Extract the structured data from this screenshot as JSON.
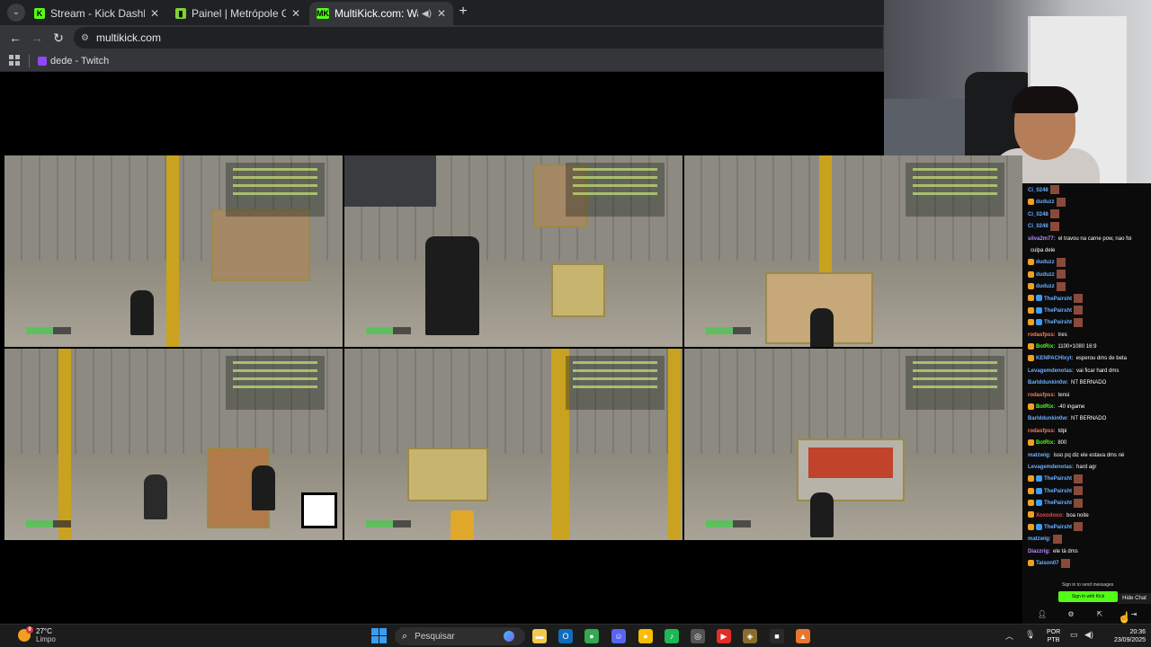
{
  "browser": {
    "tabs": [
      {
        "title": "Stream - Kick Dashboard",
        "favicon": "kick-icon",
        "color": "#53fc18",
        "active": false
      },
      {
        "title": "Painel | Metrópole GG",
        "favicon": "metropole-icon",
        "color": "#7fd33a",
        "active": false
      },
      {
        "title": "MultiKick.com: Watch Multi",
        "favicon": "multikick-icon",
        "color": "#53fc18",
        "active": true
      }
    ],
    "url": "multikick.com",
    "bookmark": "dede - Twitch"
  },
  "chat": {
    "messages": [
      {
        "user": "Ci_0248",
        "text": "",
        "color": "#6ab0ff",
        "badges": 0,
        "emote": true
      },
      {
        "user": "duduzz",
        "text": "",
        "color": "#6ab0ff",
        "badges": 1,
        "emote": true
      },
      {
        "user": "Ci_0248",
        "text": "",
        "color": "#6ab0ff",
        "badges": 0,
        "emote": true
      },
      {
        "user": "Ci_0248",
        "text": "",
        "color": "#6ab0ff",
        "badges": 0,
        "emote": true
      },
      {
        "user": "silva2m77:",
        "text": "el travou na carne pow, nao foi",
        "color": "#b28cff",
        "badges": 0,
        "emote": false
      },
      {
        "user": "",
        "text": "culpa dele",
        "color": "#ffffff",
        "badges": 0,
        "emote": false
      },
      {
        "user": "duduzz",
        "text": "",
        "color": "#6ab0ff",
        "badges": 1,
        "emote": true
      },
      {
        "user": "duduzz",
        "text": "",
        "color": "#6ab0ff",
        "badges": 1,
        "emote": true
      },
      {
        "user": "duduzz",
        "text": "",
        "color": "#6ab0ff",
        "badges": 1,
        "emote": true
      },
      {
        "user": "ThePairsht",
        "text": "",
        "color": "#6ab0ff",
        "badges": 2,
        "emote": true
      },
      {
        "user": "ThePairsht",
        "text": "",
        "color": "#6ab0ff",
        "badges": 2,
        "emote": true
      },
      {
        "user": "ThePairsht",
        "text": "",
        "color": "#6ab0ff",
        "badges": 2,
        "emote": true
      },
      {
        "user": "rodasfpss:",
        "text": "tres",
        "color": "#ff7a59",
        "badges": 0,
        "emote": false
      },
      {
        "user": "BotRix:",
        "text": "1100×1080 16:9",
        "color": "#53fc18",
        "badges": 1,
        "emote": false
      },
      {
        "user": "KENPACHIxyt:",
        "text": "esperou dms de beta",
        "color": "#6ab0ff",
        "badges": 1,
        "emote": false
      },
      {
        "user": "Levagemdenotas:",
        "text": "vai ficar hard dms",
        "color": "#6ab0ff",
        "badges": 0,
        "emote": false
      },
      {
        "user": "BarIddunkin0w:",
        "text": "NT BERNADO",
        "color": "#6ab0ff",
        "badges": 0,
        "emote": false
      },
      {
        "user": "rodasfpss:",
        "text": "tensi",
        "color": "#ff7a59",
        "badges": 0,
        "emote": false
      },
      {
        "user": "BotRix:",
        "text": "-40 ingame",
        "color": "#53fc18",
        "badges": 1,
        "emote": false
      },
      {
        "user": "BarIddunkin0w:",
        "text": "NT BERNADO",
        "color": "#6ab0ff",
        "badges": 0,
        "emote": false
      },
      {
        "user": "rodasfpss:",
        "text": "tdpi",
        "color": "#ff7a59",
        "badges": 0,
        "emote": false
      },
      {
        "user": "BotRix:",
        "text": "800",
        "color": "#53fc18",
        "badges": 1,
        "emote": false
      },
      {
        "user": "matzwig:",
        "text": "isso pq diz ele estava dms né",
        "color": "#6ab0ff",
        "badges": 0,
        "emote": false
      },
      {
        "user": "Levagemdenotas:",
        "text": "hard agr",
        "color": "#6ab0ff",
        "badges": 0,
        "emote": false
      },
      {
        "user": "ThePairsht",
        "text": "",
        "color": "#6ab0ff",
        "badges": 2,
        "emote": true
      },
      {
        "user": "ThePairsht",
        "text": "",
        "color": "#6ab0ff",
        "badges": 2,
        "emote": true
      },
      {
        "user": "ThePairsht",
        "text": "",
        "color": "#6ab0ff",
        "badges": 2,
        "emote": true
      },
      {
        "user": "Xoxodoxo:",
        "text": "boa noite",
        "color": "#ff4040",
        "badges": 1,
        "emote": false
      },
      {
        "user": "ThePairsht",
        "text": "",
        "color": "#6ab0ff",
        "badges": 2,
        "emote": true
      },
      {
        "user": "matzwig:",
        "text": "",
        "color": "#6ab0ff",
        "badges": 0,
        "emote": true
      },
      {
        "user": "Diazzrig:",
        "text": "ele tá dms",
        "color": "#b28cff",
        "badges": 0,
        "emote": false
      },
      {
        "user": "Taison07",
        "text": "",
        "color": "#6ab0ff",
        "badges": 1,
        "emote": true
      }
    ],
    "sign_hint": "Sign in to send messages",
    "sign_button": "Sign in with Kick",
    "hide_chat": "Hide Chat"
  },
  "taskbar": {
    "temperature": "27°C",
    "weather_text": "Limpo",
    "weather_alert": "9",
    "search_placeholder": "Pesquisar",
    "language_1": "POR",
    "language_2": "PTB",
    "time": "20:36",
    "date": "23/09/2025",
    "pinned": [
      {
        "name": "file-explorer-icon",
        "glyph": "▬",
        "color": "#f2c94c"
      },
      {
        "name": "outlook-icon",
        "glyph": "O",
        "color": "#0f6cbd"
      },
      {
        "name": "chrome-icon",
        "glyph": "●",
        "color": "#34a853"
      },
      {
        "name": "discord-icon",
        "glyph": "☺",
        "color": "#5865f2"
      },
      {
        "name": "chrome-alt-icon",
        "glyph": "●",
        "color": "#fbbc05"
      },
      {
        "name": "spotify-icon",
        "glyph": "♪",
        "color": "#1db954"
      },
      {
        "name": "obs-icon",
        "glyph": "◎",
        "color": "#555555"
      },
      {
        "name": "youtube-icon",
        "glyph": "▶",
        "color": "#e52d27"
      },
      {
        "name": "app-icon",
        "glyph": "◈",
        "color": "#8a6d2a"
      },
      {
        "name": "steam-like-icon",
        "glyph": "■",
        "color": "#2a2a2a"
      },
      {
        "name": "editor-icon",
        "glyph": "▲",
        "color": "#e8762c"
      }
    ]
  }
}
